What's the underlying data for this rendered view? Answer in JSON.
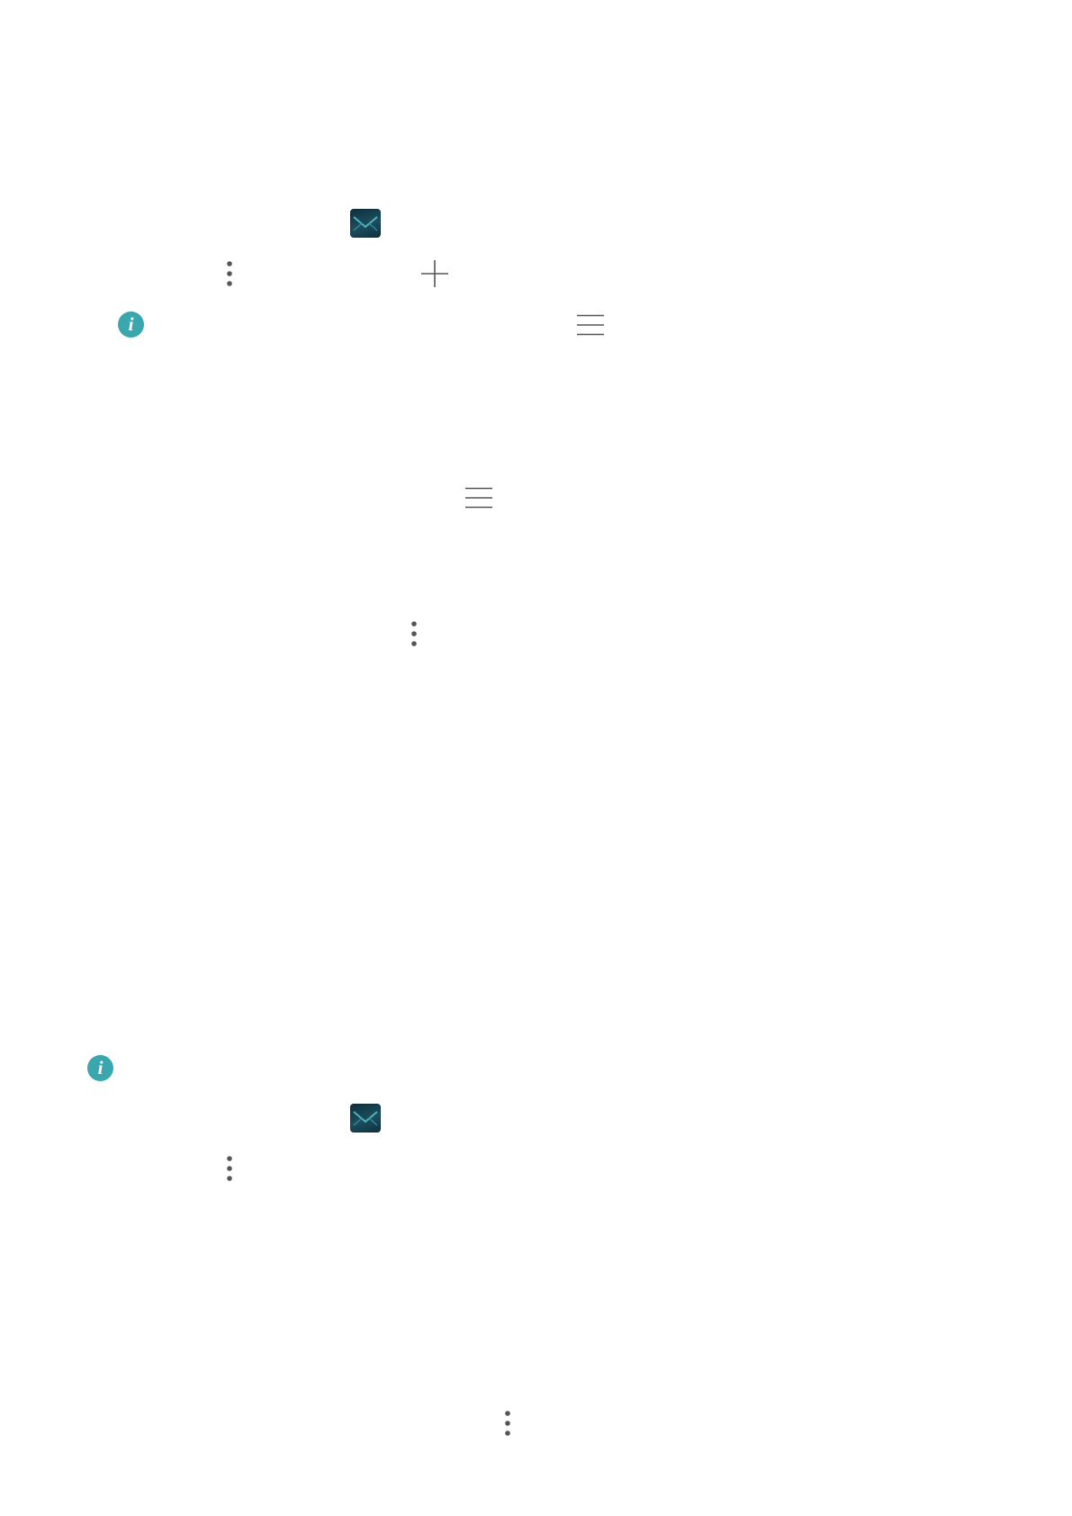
{
  "icons": {
    "email_app": "email-app-icon",
    "more": "more-vertical-icon",
    "add": "plus-icon",
    "menu": "menu-icon",
    "info": "info-icon",
    "info_glyph": "i"
  },
  "colors": {
    "info_accent": "#3aa6ad",
    "icon_gray": "#555555",
    "email_icon_bg": "#174553"
  }
}
